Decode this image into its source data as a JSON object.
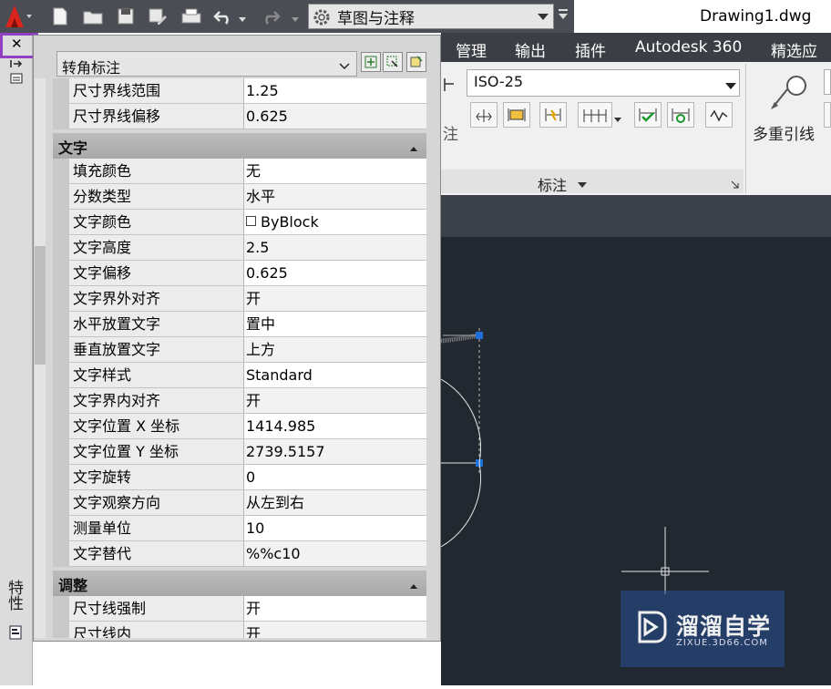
{
  "quick_access": {
    "workspace": "草图与注释",
    "title": "Drawing1.dwg",
    "icons": [
      "new-icon",
      "open-icon",
      "save-icon",
      "saveas-icon",
      "print-icon",
      "undo-icon",
      "redo-icon",
      "gear-icon"
    ]
  },
  "ribbon": {
    "tabs": [
      "管理",
      "输出",
      "插件",
      "Autodesk 360",
      "精选应用"
    ],
    "dim_style": "ISO-25",
    "panel_title": "标注",
    "mleader_label": "多重引线",
    "left_partial_label": "注"
  },
  "palette": {
    "side_label": "特性",
    "selection": "转角标注",
    "rows_top": [
      {
        "name": "尺寸界线范围",
        "value": "1.25"
      },
      {
        "name": "尺寸界线偏移",
        "value": "0.625"
      }
    ],
    "section_text": "文字",
    "rows_text": [
      {
        "name": "填充颜色",
        "value": "无"
      },
      {
        "name": "分数类型",
        "value": "水平"
      },
      {
        "name": "文字颜色",
        "value": "ByBlock",
        "swatch": true
      },
      {
        "name": "文字高度",
        "value": "2.5"
      },
      {
        "name": "文字偏移",
        "value": "0.625"
      },
      {
        "name": "文字界外对齐",
        "value": "开"
      },
      {
        "name": "水平放置文字",
        "value": "置中"
      },
      {
        "name": "垂直放置文字",
        "value": "上方"
      },
      {
        "name": "文字样式",
        "value": "Standard"
      },
      {
        "name": "文字界内对齐",
        "value": "开"
      },
      {
        "name": "文字位置 X 坐标",
        "value": "1414.985"
      },
      {
        "name": "文字位置 Y 坐标",
        "value": "2739.5157"
      },
      {
        "name": "文字旋转",
        "value": "0"
      },
      {
        "name": "文字观察方向",
        "value": "从左到右"
      },
      {
        "name": "测量单位",
        "value": "10"
      },
      {
        "name": "文字替代",
        "value": "%%c10"
      }
    ],
    "section_adjust": "调整",
    "rows_adjust": [
      {
        "name": "尺寸线强制",
        "value": "开"
      },
      {
        "name": "尺寸线内",
        "value": "开"
      }
    ]
  },
  "watermark": {
    "text": "溜溜自学",
    "sub": "ZIXUE.3D66.COM"
  }
}
